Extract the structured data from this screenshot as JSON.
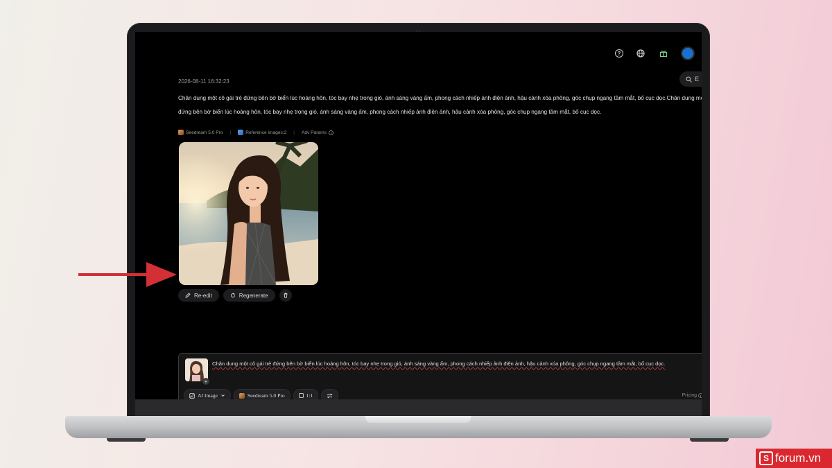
{
  "session": {
    "timestamp": "2026-08-11 16:32:23",
    "prompt_line1": "Chân dung một cô gái trẻ đứng bên bờ biển lúc hoàng hôn, tóc bay nhẹ trong gió, ánh sáng vàng ấm, phong cách nhiếp ảnh điện ảnh, hậu cảnh xóa phông, góc chụp ngang tầm mắt, bố cục dọc.Chân dung một c",
    "prompt_line2": "đứng bên bờ biển lúc hoàng hôn, tóc bay nhẹ trong gió, ánh sáng vàng ấm, phong cách nhiếp ảnh điện ảnh, hậu cảnh xóa phông, góc chụp ngang tầm mắt, bố cục dọc.",
    "meta": {
      "model": "Seedream 5.0 Pro",
      "references": "Reference images:2",
      "adv_params": "Adv Params"
    }
  },
  "actions": {
    "reedit": "Re-edit",
    "regenerate": "Regenerate"
  },
  "search_pill": "E",
  "composer": {
    "text": "Chân dung một cô gái trẻ đứng bên bờ biển lúc hoàng hôn, tóc bay nhẹ trong gió, ánh sáng vàng ấm, phong cách nhiếp ảnh điện ảnh, hậu cảnh xóa phông, góc chụp ngang tầm mắt, bố cục dọc.",
    "mode": "AI Image",
    "model": "Seedream 5.0 Pro",
    "ratio": "1:1",
    "pricing": "Pricing"
  },
  "icons": {
    "top": [
      "help-icon",
      "globe-icon",
      "gift-icon",
      "avatar"
    ],
    "actions": [
      "pencil-icon",
      "refresh-icon",
      "trash-icon"
    ]
  },
  "colors": {
    "arrow": "#d32f36",
    "watermark": "#d9282f"
  },
  "watermark": {
    "text": "forum.vn"
  }
}
